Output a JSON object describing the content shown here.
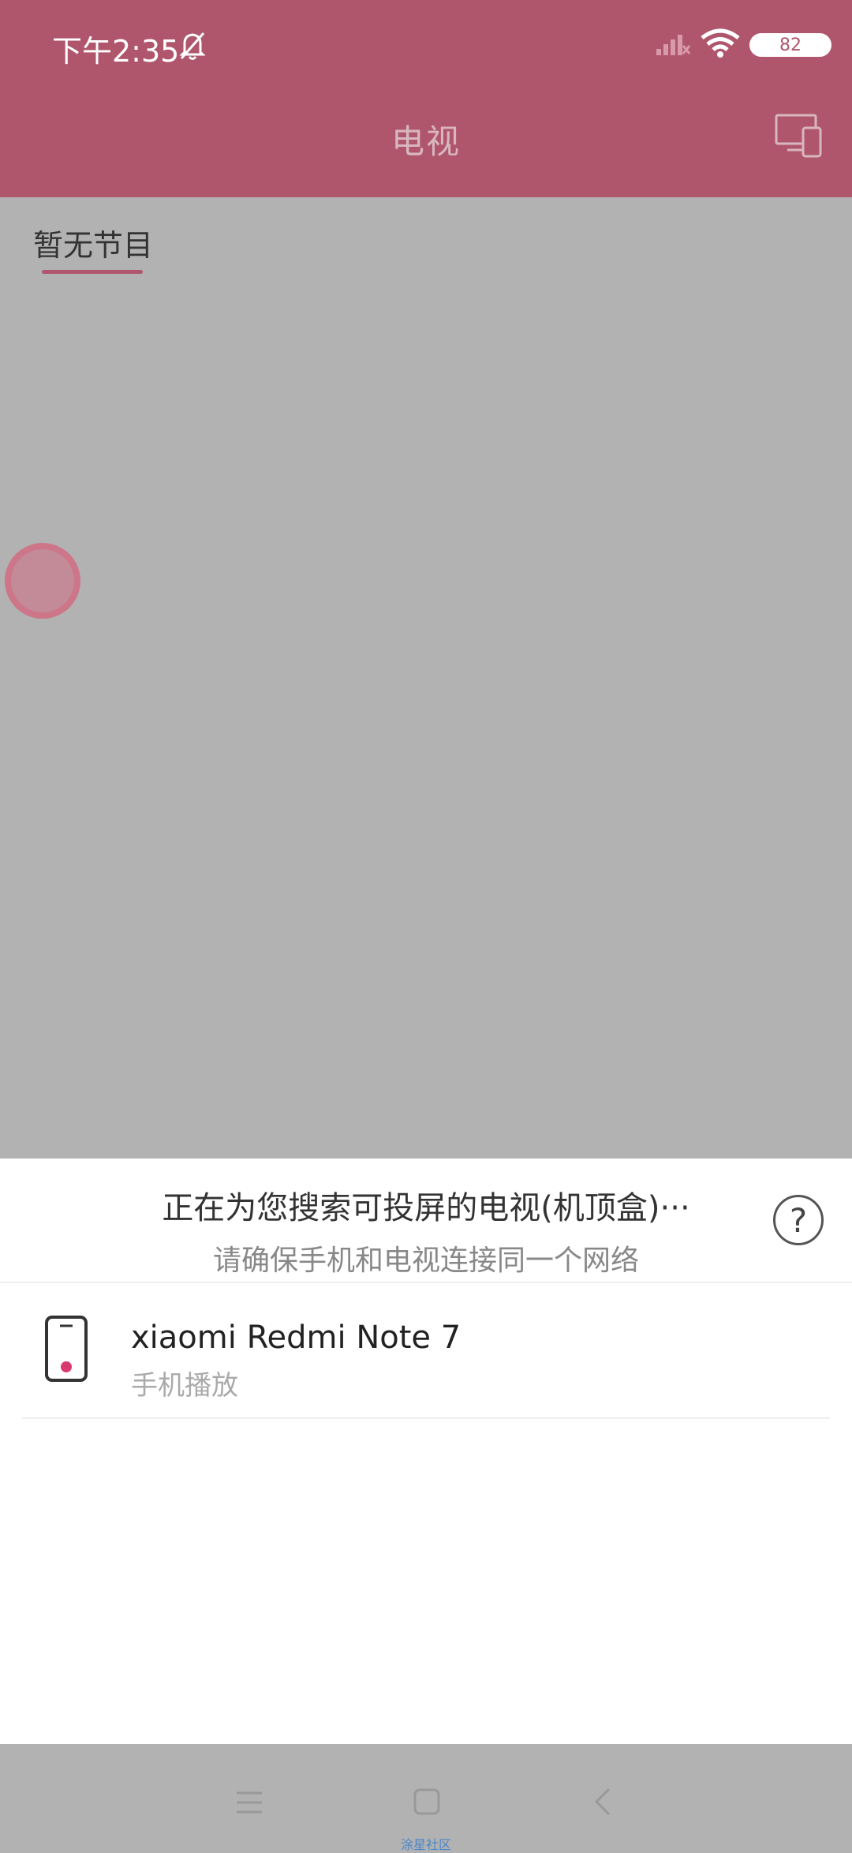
{
  "status_bar": {
    "time": "下午2:35",
    "battery": "82"
  },
  "app_bar": {
    "title": "电视"
  },
  "tab": {
    "label": "暂无节目"
  },
  "sheet": {
    "searching": "正在为您搜索可投屏的电视(机顶盒)···",
    "hint": "请确保手机和电视连接同一个网络",
    "help_label": "?",
    "devices": [
      {
        "name": "xiaomi Redmi Note 7",
        "subtitle": "手机播放"
      }
    ]
  },
  "nav_bar": {
    "caption": "涂星社区"
  },
  "colors": {
    "accent": "#b0566c",
    "overlay": "#b2b2b2"
  },
  "icons": [
    "bell-off-icon",
    "signal-icon",
    "wifi-icon",
    "battery-icon",
    "cast-screen-icon",
    "help-icon",
    "phone-icon",
    "menu-icon",
    "home-icon",
    "back-icon"
  ]
}
